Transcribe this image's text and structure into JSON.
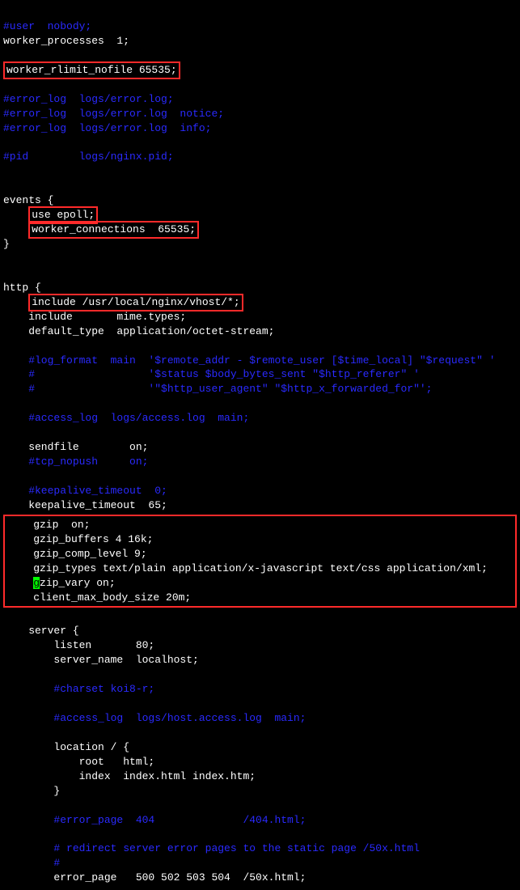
{
  "lines": {
    "l1": "#user  nobody;",
    "l2": "worker_processes  1;",
    "l3": "worker_rlimit_nofile 65535;",
    "l4": "#error_log  logs/error.log;",
    "l5": "#error_log  logs/error.log  notice;",
    "l6": "#error_log  logs/error.log  info;",
    "l7": "#pid        logs/nginx.pid;",
    "l8": "events {",
    "l9a": "    ",
    "l9b": "use epoll;",
    "l10a": "    ",
    "l10b": "worker_connections  65535;",
    "l11": "}",
    "l12": "http {",
    "l13a": "    ",
    "l13b": "include /usr/local/nginx/vhost/*;",
    "l14": "    include       mime.types;",
    "l15": "    default_type  application/octet-stream;",
    "l16": "    #log_format  main  '$remote_addr - $remote_user [$time_local] \"$request\" '",
    "l17": "    #                  '$status $body_bytes_sent \"$http_referer\" '",
    "l18": "    #                  '\"$http_user_agent\" \"$http_x_forwarded_for\"';",
    "l19": "    #access_log  logs/access.log  main;",
    "l20": "    sendfile        on;",
    "l21": "    #tcp_nopush     on;",
    "l22": "    #keepalive_timeout  0;",
    "l23": "    keepalive_timeout  65;",
    "g1": "    gzip  on;",
    "g2": "    gzip_buffers 4 16k;",
    "g3": "    gzip_comp_level 9;",
    "g4": "    gzip_types text/plain application/x-javascript text/css application/xml;",
    "g5a": "    ",
    "g5c": "g",
    "g5b": "zip_vary on;",
    "g6": "    client_max_body_size 20m;",
    "s1": "    server {",
    "s2": "        listen       80;",
    "s3": "        server_name  localhost;",
    "s4": "        #charset koi8-r;",
    "s5": "        #access_log  logs/host.access.log  main;",
    "s6": "        location / {",
    "s7": "            root   html;",
    "s8": "            index  index.html index.htm;",
    "s9": "        }",
    "s10": "        #error_page  404              /404.html;",
    "s11": "        # redirect server error pages to the static page /50x.html",
    "s12": "        #",
    "s13": "        error_page   500 502 503 504  /50x.html;"
  }
}
